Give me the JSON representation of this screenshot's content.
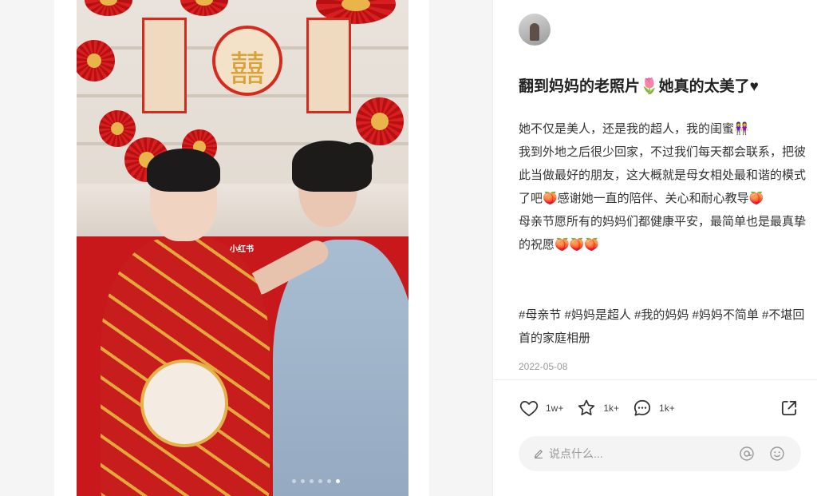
{
  "post": {
    "watermark": "小红书",
    "title": "翻到妈妈的老照片🌷她真的太美了♥",
    "paragraphs": [
      "她不仅是美人，还是我的超人，我的闺蜜👭",
      "我到外地之后很少回家，不过我们每天都会联系，把彼此当做最好的朋友，这大概就是母女相处最和谐的模式了吧🍑感谢她一直的陪伴、关心和耐心教导🍑",
      "母亲节愿所有的妈妈们都健康平安，最简单也是最真挚的祝愿🍑🍑🍑"
    ],
    "tags": "#母亲节 #妈妈是超人 #我的妈妈 #妈妈不简单 #不堪回首的家庭相册",
    "date": "2022-05-08"
  },
  "actions": {
    "like_count": "1w+",
    "collect_count": "1k+",
    "comment_count": "1k+"
  },
  "comment": {
    "placeholder": "说点什么..."
  },
  "carousel": {
    "total": 6,
    "active_index": 5
  },
  "colors": {
    "accent": "#333333",
    "date": "#999999",
    "input_bg": "#f4f4f4"
  }
}
